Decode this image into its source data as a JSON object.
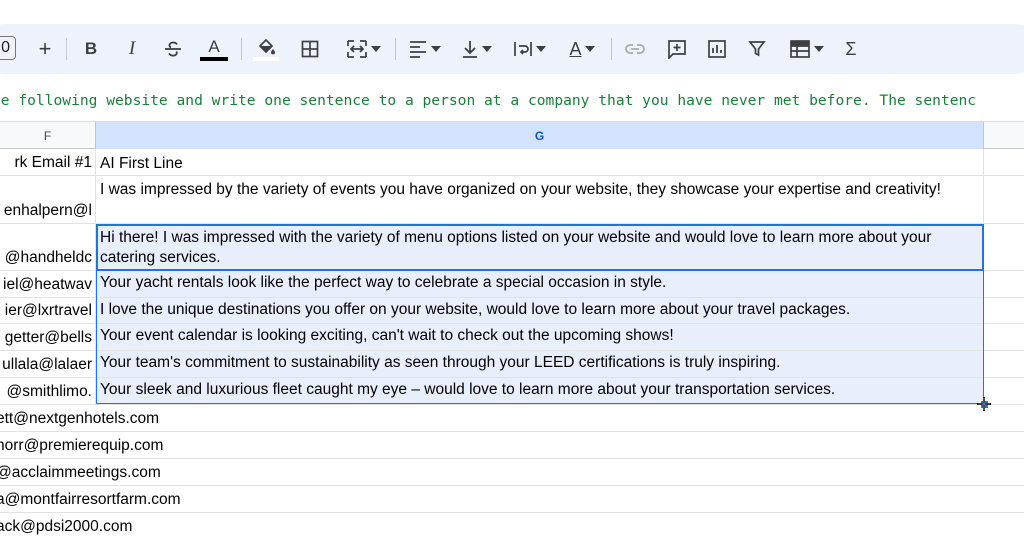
{
  "toolbar": {
    "zoom_fragment": "0",
    "items": [
      {
        "name": "add-icon",
        "glyph": "+"
      },
      {
        "name": "bold-icon",
        "glyph": "B"
      },
      {
        "name": "italic-icon",
        "glyph": "I"
      },
      {
        "name": "strikethrough-icon"
      },
      {
        "name": "text-color-icon",
        "glyph": "A"
      },
      {
        "name": "fill-color-icon"
      },
      {
        "name": "borders-icon"
      },
      {
        "name": "merge-cells-icon"
      },
      {
        "name": "horizontal-align-icon"
      },
      {
        "name": "vertical-align-icon"
      },
      {
        "name": "text-wrapping-icon"
      },
      {
        "name": "text-rotation-icon",
        "glyph": "A"
      },
      {
        "name": "insert-link-icon"
      },
      {
        "name": "insert-comment-icon"
      },
      {
        "name": "insert-chart-icon"
      },
      {
        "name": "filter-icon"
      },
      {
        "name": "filter-views-icon"
      },
      {
        "name": "functions-icon",
        "glyph": "Σ"
      }
    ],
    "text_color_underline": "#000000"
  },
  "formula": {
    "text": "he following website and write one sentence to a person at a company that you have never met before. The sentenc"
  },
  "columns": {
    "f_label": "F",
    "g_label": "G"
  },
  "rows": [
    {
      "f": "rk Email #1",
      "g": "AI First Line"
    },
    {
      "f": "enhalpern@l",
      "g": "I was impressed by the variety of events you have organized on your website, they showcase your expertise and creativity!"
    },
    {
      "f": "@handheldc",
      "g": "Hi there! I was impressed with the variety of menu options listed on your website and would love to learn more about your catering services."
    },
    {
      "f": "iel@heatwav",
      "g": "Your yacht rentals look like the perfect way to celebrate a special occasion in style."
    },
    {
      "f": "ier@lxrtravel",
      "g": "I love the unique destinations you offer on your website, would love to learn more about your travel packages."
    },
    {
      "f": "getter@bells",
      "g": "Your event calendar is looking exciting, can't wait to check out the upcoming shows!"
    },
    {
      "f": "ullala@lalaer",
      "g": "Your team's commitment to sustainability as seen through your LEED certifications is truly inspiring."
    },
    {
      "f": "@smithlimo.",
      "g": "Your sleek and luxurious fleet caught my eye – would love to learn more about your transportation services."
    },
    {
      "f": "ett@nextgenhotels.com",
      "g": ""
    },
    {
      "f": "horr@premierequip.com",
      "g": ""
    },
    {
      "f": "@acclaimmeetings.com",
      "g": ""
    },
    {
      "f": "a@montfairresortfarm.com",
      "g": ""
    },
    {
      "f": "ack@pdsi2000.com",
      "g": ""
    }
  ],
  "colors": {
    "accent": "#1a73e8",
    "formula_text": "#188038",
    "selected_header": "#d3e3fd",
    "selected_fill": "#e8eefb"
  }
}
